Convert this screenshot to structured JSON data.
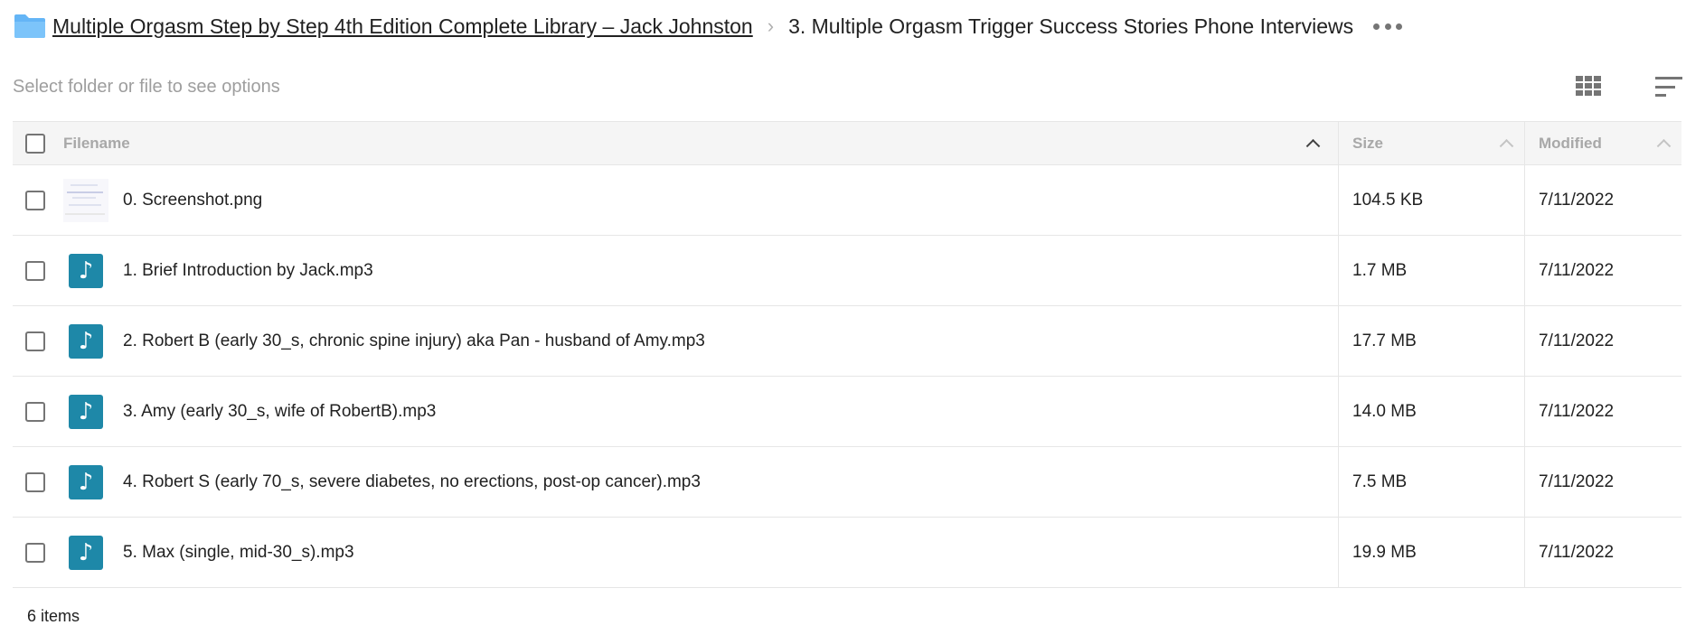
{
  "breadcrumb": {
    "parent": "Multiple Orgasm Step by Step 4th Edition Complete Library – Jack Johnston",
    "separator": "›",
    "current": "3. Multiple Orgasm Trigger Success Stories Phone Interviews"
  },
  "toolbar": {
    "hint": "Select folder or file to see options"
  },
  "table": {
    "columns": {
      "name": "Filename",
      "size": "Size",
      "modified": "Modified"
    },
    "rows": [
      {
        "name": "0. Screenshot.png",
        "size": "104.5 KB",
        "modified": "7/11/2022",
        "type": "image"
      },
      {
        "name": "1. Brief Introduction by Jack.mp3",
        "size": "1.7 MB",
        "modified": "7/11/2022",
        "type": "audio"
      },
      {
        "name": "2. Robert B (early 30_s, chronic spine injury) aka Pan - husband of Amy.mp3",
        "size": "17.7 MB",
        "modified": "7/11/2022",
        "type": "audio"
      },
      {
        "name": "3. Amy (early 30_s, wife of RobertB).mp3",
        "size": "14.0 MB",
        "modified": "7/11/2022",
        "type": "audio"
      },
      {
        "name": "4. Robert S (early 70_s, severe diabetes, no erections, post-op cancer).mp3",
        "size": "7.5 MB",
        "modified": "7/11/2022",
        "type": "audio"
      },
      {
        "name": "5. Max (single, mid-30_s).mp3",
        "size": "19.9 MB",
        "modified": "7/11/2022",
        "type": "audio"
      }
    ]
  },
  "footer": {
    "count": "6 items"
  },
  "icons": {
    "folder": "folder-icon",
    "audio": "music-note-icon",
    "image": "image-thumbnail",
    "more": "more-horizontal-icon",
    "grid": "grid-view-icon",
    "sort": "sort-icon"
  },
  "colors": {
    "folder": "#64b5f6",
    "audio_tile": "#1e88a8",
    "hint_text": "#9e9e9e",
    "header_bg": "#f5f5f5"
  }
}
